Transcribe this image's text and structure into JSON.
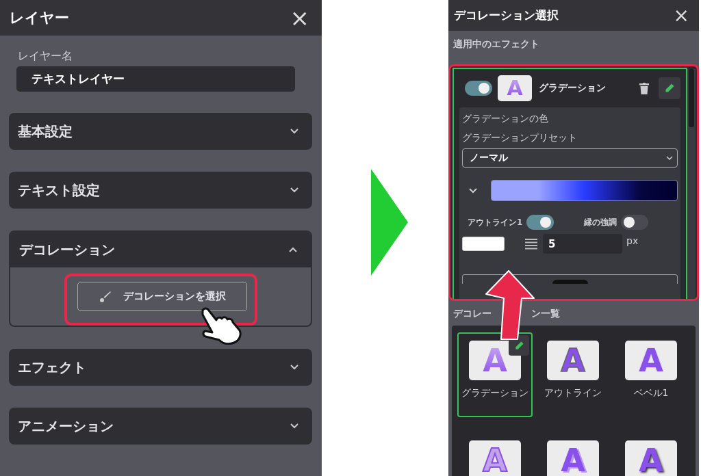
{
  "layer_panel": {
    "title": "レイヤー",
    "close": "×",
    "name_label": "レイヤー名",
    "name_value": "テキストレイヤー",
    "sections": [
      {
        "title": "基本設定",
        "expanded": false
      },
      {
        "title": "テキスト設定",
        "expanded": false
      },
      {
        "title": "デコレーション",
        "expanded": true,
        "button": "デコレーションを選択"
      },
      {
        "title": "エフェクト",
        "expanded": false
      },
      {
        "title": "アニメーション",
        "expanded": false
      }
    ]
  },
  "decoration_panel": {
    "title": "デコレーション選択",
    "close": "×",
    "applied_label": "適用中のエフェクト",
    "effect": {
      "on": true,
      "sample": "A",
      "name": "グラデーション",
      "color_label": "グラデーションの色",
      "preset_label": "グラデーションプリセット",
      "preset_value": "ノーマル",
      "toggles": [
        {
          "label": "アウトライン1",
          "on": true
        },
        {
          "label": "縁の強調",
          "on": false
        }
      ],
      "width_value": "5",
      "unit": "px"
    },
    "list_label_parts": [
      "デコレー",
      "ン一覧"
    ],
    "tiles": [
      {
        "kind": "gradient",
        "sample": "A",
        "label": "グラデーション",
        "selected": true
      },
      {
        "kind": "outline",
        "sample": "A",
        "label": "アウトライン",
        "selected": false
      },
      {
        "kind": "bevel",
        "sample": "A",
        "label": "ベベル1",
        "selected": false
      },
      {
        "kind": "soft",
        "sample": "A",
        "selected": false
      },
      {
        "kind": "extrude",
        "sample": "A",
        "selected": false
      },
      {
        "kind": "shadow",
        "sample": "A",
        "selected": false
      }
    ]
  }
}
